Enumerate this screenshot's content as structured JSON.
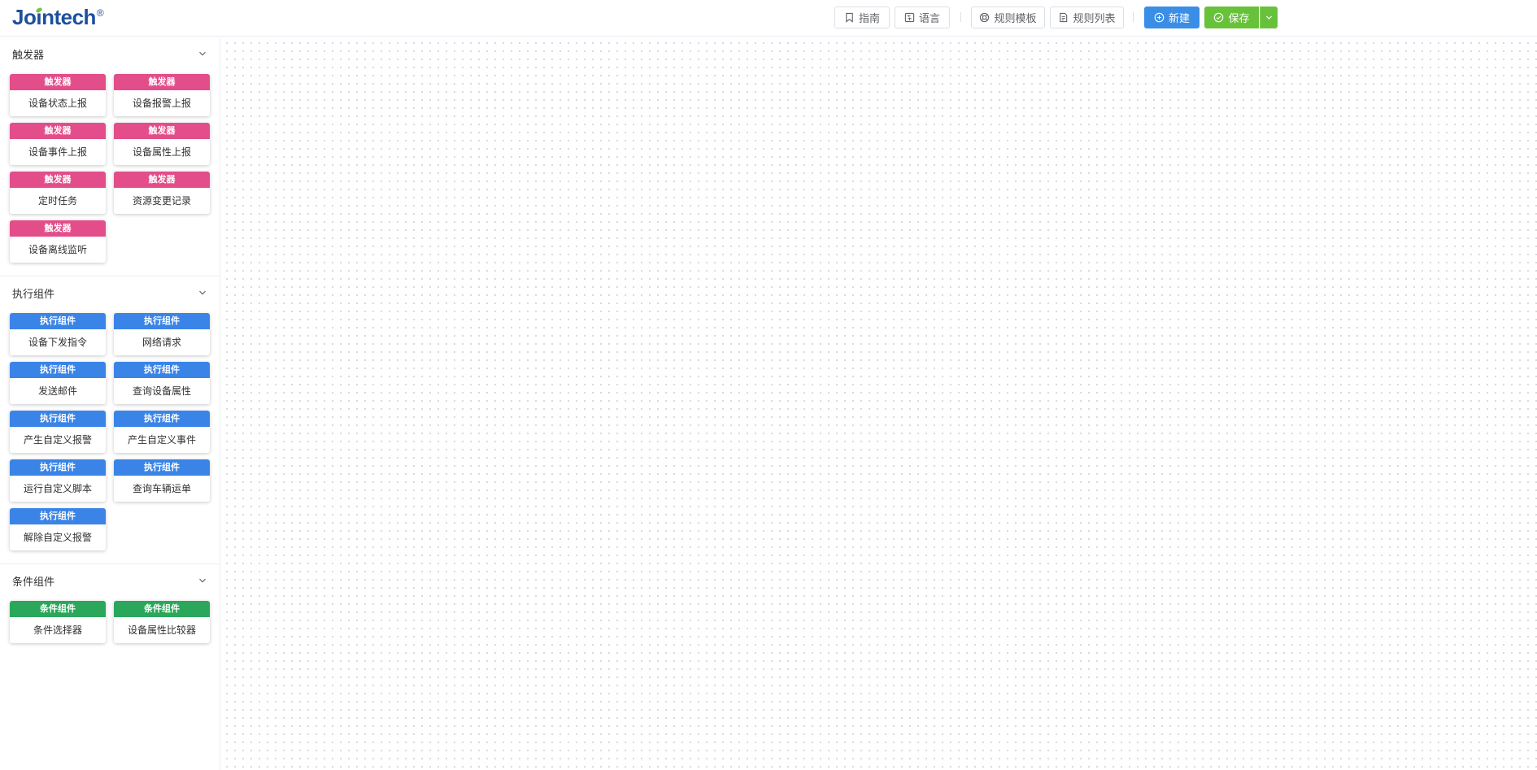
{
  "header": {
    "logo_text": "Jointech",
    "logo_mark": "®",
    "buttons": {
      "guide": "指南",
      "language": "语言",
      "templates": "规则模板",
      "list": "规则列表",
      "new": "新建",
      "save": "保存"
    }
  },
  "colors": {
    "trigger": "#e34d8a",
    "action": "#3a84e8",
    "condition": "#2aa75a"
  },
  "sidebar": {
    "sections": [
      {
        "title": "触发器",
        "tag": "触发器",
        "items": [
          "设备状态上报",
          "设备报警上报",
          "设备事件上报",
          "设备属性上报",
          "定时任务",
          "资源变更记录",
          "设备离线监听"
        ]
      },
      {
        "title": "执行组件",
        "tag": "执行组件",
        "items": [
          "设备下发指令",
          "网络请求",
          "发送邮件",
          "查询设备属性",
          "产生自定义报警",
          "产生自定义事件",
          "运行自定义脚本",
          "查询车辆运单",
          "解除自定义报警"
        ]
      },
      {
        "title": "条件组件",
        "tag": "条件组件",
        "items": [
          "条件选择器",
          "设备属性比较器"
        ]
      }
    ]
  }
}
